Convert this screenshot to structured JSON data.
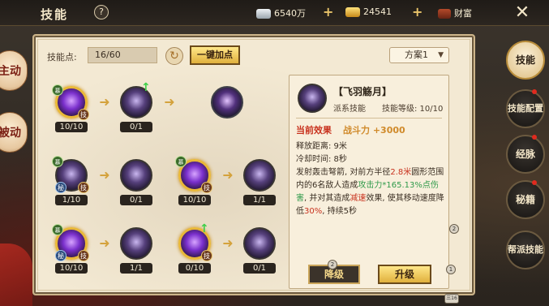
{
  "topbar": {
    "title": "技能",
    "help": "?",
    "silver": "6540万",
    "gold": "24541",
    "wealth": "财富",
    "close": "✕"
  },
  "side_tabs": [
    "主动",
    "被动"
  ],
  "panel": {
    "skill_points_label": "技能点:",
    "skill_points_value": "16/60",
    "one_click_label": "一键加点",
    "scheme": "方案1"
  },
  "skills": {
    "row1": [
      "10/10",
      "0/1",
      ""
    ],
    "row2": [
      "1/10",
      "0/1",
      "10/10",
      "1/1"
    ],
    "row3": [
      "10/10",
      "1/1",
      "0/10",
      "0/1"
    ]
  },
  "badges": {
    "ji": "技",
    "mi": "秘",
    "xin": "慕"
  },
  "detail": {
    "name": "【飞羽觞月】",
    "school": "派系技能",
    "level": "技能等级: 10/10",
    "current_label": "当前效果",
    "current_value": "战斗力 +3000",
    "range": "释放距离: 9米",
    "cooldown": "冷却时间: 8秒",
    "desc_1": "发射轰击弩箭, 对前方半径",
    "desc_2": "2.8米",
    "desc_3": "圆形范围内的6名敌人造成",
    "desc_4": "攻击力*165.13%点伤害",
    "desc_5": ", 并对其造成",
    "desc_6": "减速",
    "desc_7": "效果, 使其移动速度降低",
    "desc_8": "30%",
    "desc_9": ", 持续5秒"
  },
  "buttons": {
    "downgrade": "降级",
    "upgrade": "升级"
  },
  "right_menu": [
    {
      "label": "技能",
      "active": true
    },
    {
      "label": "技能配置",
      "active": false
    },
    {
      "label": "经脉",
      "active": false
    },
    {
      "label": "秘籍",
      "active": false
    },
    {
      "label": "帮派技能",
      "active": false
    }
  ],
  "knobs": [
    "2",
    "1",
    "2",
    "三16"
  ]
}
